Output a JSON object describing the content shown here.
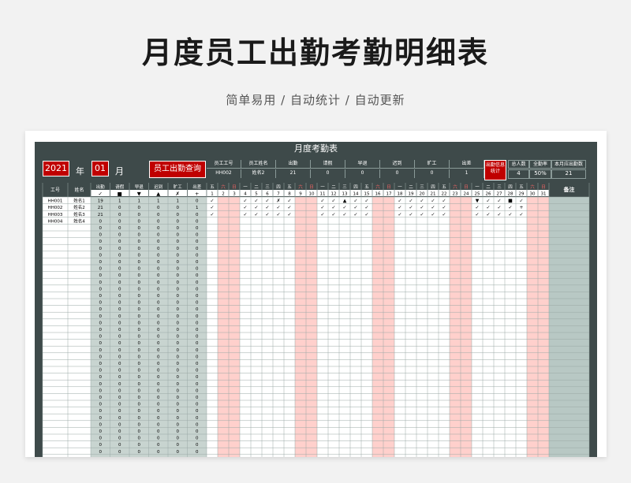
{
  "title": "月度员工出勤考勤明细表",
  "subtitle": "简单易用 / 自动统计 / 自动更新",
  "sheet": {
    "title": "月度考勤表",
    "year": "2021",
    "year_label": "年",
    "month": "01",
    "month_label": "月",
    "query_button": "员工出勤查询",
    "query_headers": [
      "员工工号",
      "员工姓名",
      "出勤",
      "请假",
      "早退",
      "迟到",
      "旷工",
      "出差"
    ],
    "query_values": [
      "HH002",
      "姓名2",
      "21",
      "0",
      "0",
      "0",
      "0",
      "1"
    ],
    "stats_label_line1": "出勤信息",
    "stats_label_line2": "统计",
    "stats_headers": [
      "总人数",
      "全勤率",
      "本月应出勤数"
    ],
    "stats_values": [
      "4",
      "50%",
      "21"
    ],
    "col_headers": {
      "id": "工号",
      "name": "姓名",
      "remark": "备注"
    },
    "status_headers": [
      "出勤",
      "请假",
      "早退",
      "迟到",
      "旷工",
      "出差"
    ],
    "status_symbols": [
      "✓",
      "■",
      "▼",
      "▲",
      "✗",
      "+"
    ],
    "weekdays": [
      "五",
      "六",
      "日",
      "一",
      "二",
      "三",
      "四",
      "五",
      "六",
      "日",
      "一",
      "二",
      "三",
      "四",
      "五",
      "六",
      "日",
      "一",
      "二",
      "三",
      "四",
      "五",
      "六",
      "日",
      "一",
      "二",
      "三",
      "四",
      "五",
      "六",
      "日"
    ],
    "days": [
      "1",
      "2",
      "3",
      "4",
      "5",
      "6",
      "7",
      "8",
      "9",
      "10",
      "11",
      "12",
      "13",
      "14",
      "15",
      "16",
      "17",
      "18",
      "19",
      "20",
      "21",
      "22",
      "23",
      "24",
      "25",
      "26",
      "27",
      "28",
      "29",
      "30",
      "31"
    ],
    "weekend_days": [
      2,
      3,
      9,
      10,
      16,
      17,
      23,
      24,
      30,
      31
    ],
    "employees": [
      {
        "id": "HH001",
        "name": "姓名1",
        "counts": [
          "19",
          "1",
          "1",
          "1",
          "1",
          "0"
        ],
        "marks": {
          "1": "✓",
          "4": "✓",
          "5": "✓",
          "6": "✓",
          "7": "✗",
          "8": "✓",
          "11": "✓",
          "12": "✓",
          "13": "▲",
          "14": "✓",
          "15": "✓",
          "18": "✓",
          "19": "✓",
          "20": "✓",
          "21": "✓",
          "22": "✓",
          "25": "▼",
          "26": "✓",
          "27": "✓",
          "28": "■",
          "29": "✓"
        }
      },
      {
        "id": "HH002",
        "name": "姓名2",
        "counts": [
          "21",
          "0",
          "0",
          "0",
          "0",
          "1"
        ],
        "marks": {
          "1": "✓",
          "4": "✓",
          "5": "✓",
          "6": "✓",
          "7": "✓",
          "8": "✓",
          "11": "✓",
          "12": "✓",
          "13": "✓",
          "14": "✓",
          "15": "✓",
          "18": "✓",
          "19": "✓",
          "20": "✓",
          "21": "✓",
          "22": "✓",
          "25": "✓",
          "26": "✓",
          "27": "✓",
          "28": "✓",
          "29": "+"
        }
      },
      {
        "id": "HH003",
        "name": "姓名3",
        "counts": [
          "21",
          "0",
          "0",
          "0",
          "0",
          "0"
        ],
        "marks": {
          "1": "✓",
          "4": "✓",
          "5": "✓",
          "6": "✓",
          "7": "✓",
          "8": "✓",
          "11": "✓",
          "12": "✓",
          "13": "✓",
          "14": "✓",
          "15": "✓",
          "18": "✓",
          "19": "✓",
          "20": "✓",
          "21": "✓",
          "22": "✓",
          "25": "✓",
          "26": "✓",
          "27": "✓",
          "28": "✓",
          "29": "✓"
        }
      },
      {
        "id": "HH004",
        "name": "姓名4",
        "counts": [
          "0",
          "0",
          "0",
          "0",
          "0",
          "0"
        ],
        "marks": {}
      }
    ],
    "empty_rows": 34,
    "empty_count_value": "0"
  },
  "colors": {
    "sheet_bg": "#3e4a4a",
    "red": "#c00000",
    "weekend": "#ffd0cc",
    "count_bg": "#c8d4d0",
    "remark_bg": "#b8c8c4"
  }
}
